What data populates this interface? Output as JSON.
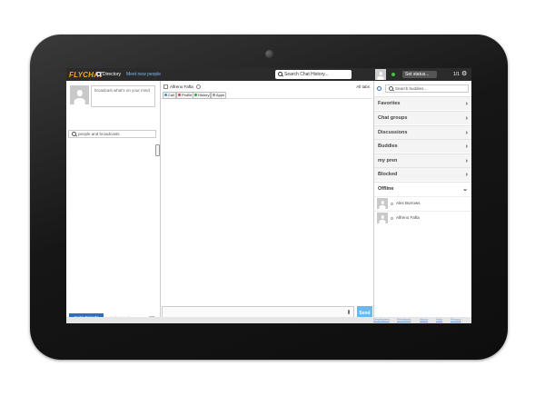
{
  "app": {
    "logo_text": "FLYCHAT",
    "brand_color": "#f5a623"
  },
  "topbar": {
    "directory_label": "Directory",
    "meet_label": "Meet new people",
    "search_placeholder": "Search Chat History...",
    "status_label": "Set status...",
    "count": "1/1",
    "status_color": "#3ec43e"
  },
  "left": {
    "status_text": "broadcast what's on your mind",
    "people_search_placeholder": "people and broadcasts",
    "invite_label": "Invite Friends",
    "find_label": "Find Friends",
    "cp_label": "CP"
  },
  "chat": {
    "contact_name": "Alfreno Fafta",
    "all_tabs_label": "All tabs",
    "tools": [
      "Call",
      "Profile",
      "History",
      "Apps"
    ],
    "send_label": "Send",
    "accent": "#6cb8ea"
  },
  "buddies": {
    "search_placeholder": "Search buddies...",
    "groups": [
      "Favorites",
      "Chat groups",
      "Discussions",
      "Buddies",
      "my pren",
      "Blocked"
    ],
    "offline_label": "Offline",
    "offline_users": [
      "Alex Burrows",
      "Alfreno Fafta"
    ]
  },
  "footer": {
    "links": [
      "Developers",
      "Feedback",
      "About",
      "Help",
      "Privacy"
    ]
  }
}
